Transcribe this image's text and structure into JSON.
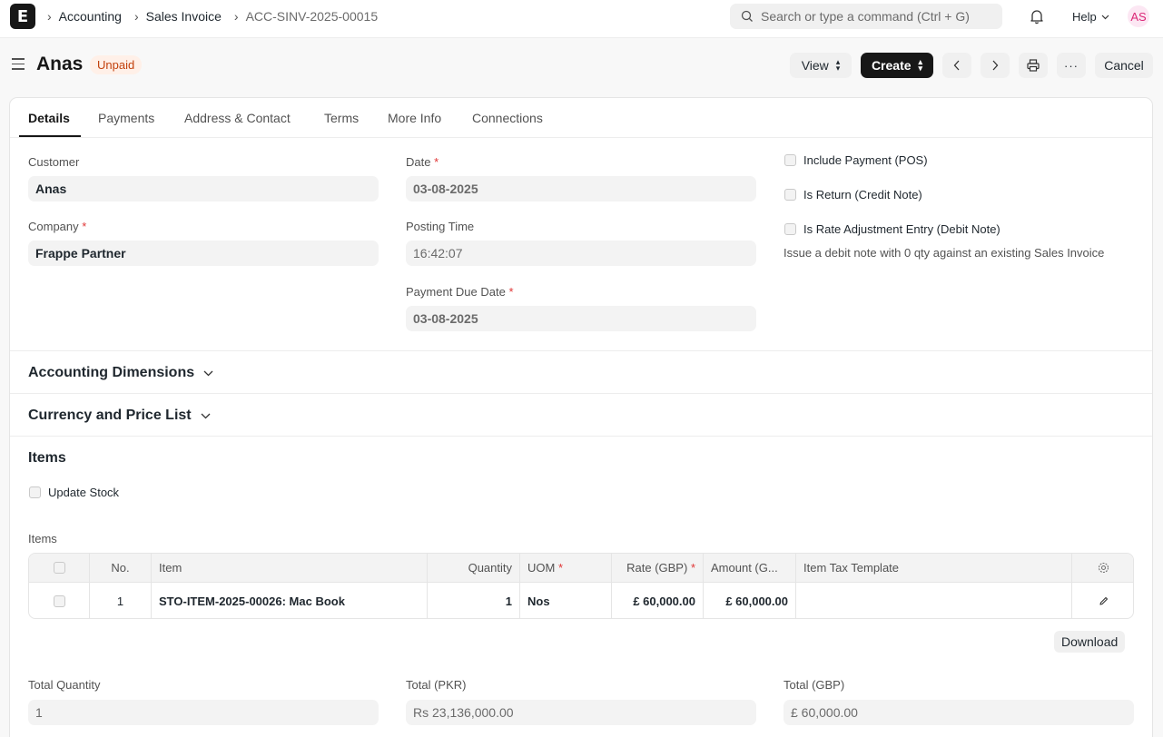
{
  "navbar": {
    "logo_letter": "E",
    "breadcrumbs": [
      "Accounting",
      "Sales Invoice",
      "ACC-SINV-2025-00015"
    ],
    "search_placeholder": "Search or type a command (Ctrl + G)",
    "help_label": "Help",
    "avatar_initials": "AS"
  },
  "header": {
    "title": "Anas",
    "status": "Unpaid",
    "view_label": "View",
    "create_label": "Create",
    "cancel_label": "Cancel"
  },
  "tabs": [
    "Details",
    "Payments",
    "Address & Contact",
    "Terms",
    "More Info",
    "Connections"
  ],
  "form": {
    "customer_label": "Customer",
    "customer_value": "Anas",
    "company_label": "Company",
    "company_value": "Frappe Partner",
    "date_label": "Date",
    "date_value": "03-08-2025",
    "posting_time_label": "Posting Time",
    "posting_time_value": "16:42:07",
    "due_date_label": "Payment Due Date",
    "due_date_value": "03-08-2025",
    "include_payment_label": "Include Payment (POS)",
    "is_return_label": "Is Return (Credit Note)",
    "rate_adjustment_label": "Is Rate Adjustment Entry (Debit Note)",
    "rate_adjustment_desc": "Issue a debit note with 0 qty against an existing Sales Invoice"
  },
  "sections": {
    "accounting_dimensions": "Accounting Dimensions",
    "currency_price_list": "Currency and Price List",
    "items": "Items"
  },
  "items_section": {
    "update_stock_label": "Update Stock",
    "table_label": "Items",
    "columns": [
      "No.",
      "Item",
      "Quantity",
      "UOM",
      "Rate (GBP)",
      "Amount (G...",
      "Item Tax Template"
    ],
    "rows": [
      {
        "no": "1",
        "item": "STO-ITEM-2025-00026: Mac Book",
        "qty": "1",
        "uom": "Nos",
        "rate": "£ 60,000.00",
        "amount": "£ 60,000.00",
        "tax_template": ""
      }
    ],
    "download_label": "Download"
  },
  "totals": {
    "total_qty_label": "Total Quantity",
    "total_qty_value": "1",
    "total_pkr_label": "Total (PKR)",
    "total_pkr_value": "Rs 23,136,000.00",
    "total_gbp_label": "Total (GBP)",
    "total_gbp_value": "£ 60,000.00"
  }
}
